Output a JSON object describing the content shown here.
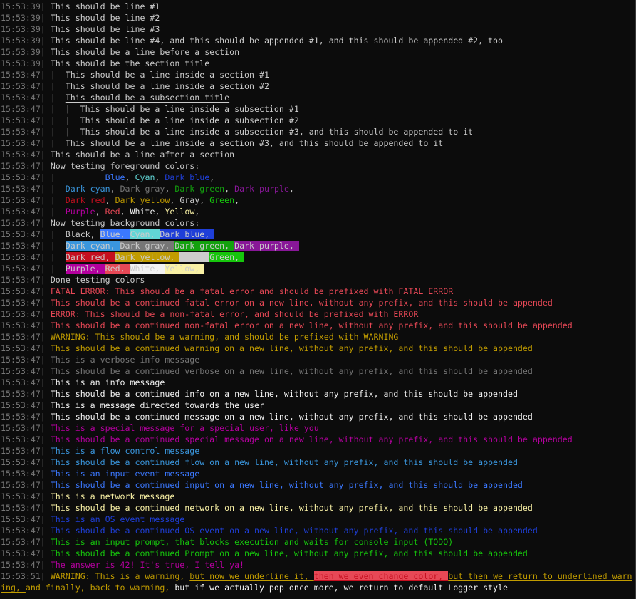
{
  "colors": {
    "default": "#cccccc",
    "timestamp": "#767676",
    "Black": "#0c0c0c",
    "Blue": "#3b78ff",
    "Cyan": "#61d6d6",
    "DarkBlue": "#1f3fd8",
    "DarkCyan": "#3a96dd",
    "DarkGray": "#767676",
    "DarkGreen": "#13a10e",
    "DarkPurple": "#881798",
    "DarkRed": "#c50f1f",
    "DarkYellow": "#c19c00",
    "Gray": "#cccccc",
    "Green": "#16c60c",
    "Purple": "#b4009e",
    "Red": "#e74856",
    "White": "#f2f2f2",
    "Yellow": "#f9f1a5"
  },
  "lines": [
    {
      "ts": "15:53:39",
      "segs": [
        {
          "t": "This should be line #1"
        }
      ]
    },
    {
      "ts": "15:53:39",
      "segs": [
        {
          "t": "This should be line #2"
        }
      ]
    },
    {
      "ts": "15:53:39",
      "segs": [
        {
          "t": "This should be line #3"
        }
      ]
    },
    {
      "ts": "15:53:39",
      "segs": [
        {
          "t": "This should be line #4, and this should be appended #1, and this should be appended #2, too"
        }
      ]
    },
    {
      "ts": "15:53:39",
      "segs": [
        {
          "t": "This should be a line before a section"
        }
      ]
    },
    {
      "ts": "15:53:39",
      "segs": [
        {
          "t": "This should be the section title",
          "u": true
        }
      ]
    },
    {
      "ts": "15:53:47",
      "segs": [
        {
          "t": "|  This should be a line inside a section #1"
        }
      ]
    },
    {
      "ts": "15:53:47",
      "segs": [
        {
          "t": "|  This should be a line inside a section #2"
        }
      ]
    },
    {
      "ts": "15:53:47",
      "segs": [
        {
          "t": "|  "
        },
        {
          "t": "This should be a subsection title",
          "u": true
        }
      ]
    },
    {
      "ts": "15:53:47",
      "segs": [
        {
          "t": "|  |  This should be a line inside a subsection #1"
        }
      ]
    },
    {
      "ts": "15:53:47",
      "segs": [
        {
          "t": "|  |  This should be a line inside a subsection #2"
        }
      ]
    },
    {
      "ts": "15:53:47",
      "segs": [
        {
          "t": "|  |  This should be a line inside a subsection #3, and this should be appended to it"
        }
      ]
    },
    {
      "ts": "15:53:47",
      "segs": [
        {
          "t": "|  This should be a line inside a section #3, and this should be appended to it"
        }
      ]
    },
    {
      "ts": "15:53:47",
      "segs": [
        {
          "t": "This should be a line after a section"
        }
      ]
    },
    {
      "ts": "15:53:47",
      "segs": [
        {
          "t": "Now testing foreground colors:"
        }
      ]
    },
    {
      "ts": "15:53:47",
      "segs": [
        {
          "t": "|  "
        },
        {
          "t": "        "
        },
        {
          "t": "Blue",
          "fg": "#3b78ff"
        },
        {
          "t": ", "
        },
        {
          "t": "Cyan",
          "fg": "#61d6d6"
        },
        {
          "t": ", "
        },
        {
          "t": "Dark blue",
          "fg": "#1f3fd8"
        },
        {
          "t": ","
        }
      ]
    },
    {
      "ts": "15:53:47",
      "segs": [
        {
          "t": "|  "
        },
        {
          "t": "Dark cyan",
          "fg": "#3a96dd"
        },
        {
          "t": ", "
        },
        {
          "t": "Dark gray",
          "fg": "#767676"
        },
        {
          "t": ", "
        },
        {
          "t": "Dark green",
          "fg": "#13a10e"
        },
        {
          "t": ", "
        },
        {
          "t": "Dark purple",
          "fg": "#881798"
        },
        {
          "t": ","
        }
      ]
    },
    {
      "ts": "15:53:47",
      "segs": [
        {
          "t": "|  "
        },
        {
          "t": "Dark red",
          "fg": "#c50f1f"
        },
        {
          "t": ", "
        },
        {
          "t": "Dark yellow",
          "fg": "#c19c00"
        },
        {
          "t": ", "
        },
        {
          "t": "Gray",
          "fg": "#cccccc"
        },
        {
          "t": ", "
        },
        {
          "t": "Green",
          "fg": "#16c60c"
        },
        {
          "t": ","
        }
      ]
    },
    {
      "ts": "15:53:47",
      "segs": [
        {
          "t": "|  "
        },
        {
          "t": "Purple",
          "fg": "#b4009e"
        },
        {
          "t": ", "
        },
        {
          "t": "Red",
          "fg": "#e74856"
        },
        {
          "t": ", "
        },
        {
          "t": "White",
          "fg": "#f2f2f2"
        },
        {
          "t": ", "
        },
        {
          "t": "Yellow",
          "fg": "#f9f1a5"
        },
        {
          "t": ","
        }
      ]
    },
    {
      "ts": "15:53:47",
      "segs": [
        {
          "t": "Now testing background colors:"
        }
      ]
    },
    {
      "ts": "15:53:47",
      "segs": [
        {
          "t": "|  "
        },
        {
          "t": "Black, ",
          "bg": "#0c0c0c"
        },
        {
          "t": "Blue, ",
          "bg": "#3b78ff"
        },
        {
          "t": "Cyan, ",
          "bg": "#61d6d6"
        },
        {
          "t": "Dark blue, ",
          "bg": "#1f3fd8"
        }
      ]
    },
    {
      "ts": "15:53:47",
      "segs": [
        {
          "t": "|  "
        },
        {
          "t": "Dark cyan, ",
          "bg": "#3a96dd"
        },
        {
          "t": "Dark gray, ",
          "bg": "#767676"
        },
        {
          "t": "Dark green, ",
          "bg": "#13a10e"
        },
        {
          "t": "Dark purple, ",
          "bg": "#881798"
        }
      ]
    },
    {
      "ts": "15:53:47",
      "segs": [
        {
          "t": "|  "
        },
        {
          "t": "Dark red, ",
          "bg": "#c50f1f"
        },
        {
          "t": "Dark yellow, ",
          "bg": "#c19c00"
        },
        {
          "t": "      ",
          "bg": "#cccccc"
        },
        {
          "t": "Green, ",
          "bg": "#16c60c"
        }
      ]
    },
    {
      "ts": "15:53:47",
      "segs": [
        {
          "t": "|  "
        },
        {
          "t": "Purple, ",
          "bg": "#b4009e"
        },
        {
          "t": "Red, ",
          "bg": "#e74856"
        },
        {
          "t": "White, ",
          "bg": "#f2f2f2"
        },
        {
          "t": "Yellow, ",
          "bg": "#f9f1a5"
        }
      ]
    },
    {
      "ts": "15:53:47",
      "segs": [
        {
          "t": "Done testing colors"
        }
      ]
    },
    {
      "ts": "15:53:47",
      "segs": [
        {
          "t": "FATAL ERROR: This should be a fatal error and should be prefixed with FATAL ERROR",
          "fg": "#e74856"
        }
      ]
    },
    {
      "ts": "15:53:47",
      "segs": [
        {
          "t": "This should be a continued fatal error on a new line, without any prefix, and this should be appended",
          "fg": "#e74856"
        }
      ]
    },
    {
      "ts": "15:53:47",
      "segs": [
        {
          "t": "ERROR: This should be a non-fatal error, and should be prefixed with ERROR",
          "fg": "#e74856"
        }
      ]
    },
    {
      "ts": "15:53:47",
      "segs": [
        {
          "t": "This should be a continued non-fatal error on a new line, without any prefix, and this should be appended",
          "fg": "#e74856"
        }
      ]
    },
    {
      "ts": "15:53:47",
      "segs": [
        {
          "t": "WARNING: This should be a warning, and should be prefixed with WARNING",
          "fg": "#c19c00"
        }
      ]
    },
    {
      "ts": "15:53:47",
      "segs": [
        {
          "t": "This should be a continued warning on a new line, without any prefix, and this should be appended",
          "fg": "#c19c00"
        }
      ]
    },
    {
      "ts": "15:53:47",
      "segs": [
        {
          "t": "This is a verbose info message",
          "fg": "#767676"
        }
      ]
    },
    {
      "ts": "15:53:47",
      "segs": [
        {
          "t": "This should be a continued verbose on a new line, without any prefix, and this should be appended",
          "fg": "#767676"
        }
      ]
    },
    {
      "ts": "15:53:47",
      "segs": [
        {
          "t": "This is an info message",
          "fg": "#f2f2f2"
        }
      ]
    },
    {
      "ts": "15:53:47",
      "segs": [
        {
          "t": "This should be a continued info on a new line, without any prefix, and this should be appended",
          "fg": "#f2f2f2"
        }
      ]
    },
    {
      "ts": "15:53:47",
      "segs": [
        {
          "t": "This is a message directed towards the user",
          "fg": "#f2f2f2"
        }
      ]
    },
    {
      "ts": "15:53:47",
      "segs": [
        {
          "t": "This should be a continued message on a new line, without any prefix, and this should be appended",
          "fg": "#f2f2f2"
        }
      ]
    },
    {
      "ts": "15:53:47",
      "segs": [
        {
          "t": "This is a special message for a special user, like you",
          "fg": "#b4009e"
        }
      ]
    },
    {
      "ts": "15:53:47",
      "segs": [
        {
          "t": "This should be a continued special message on a new line, without any prefix, and this should be appended",
          "fg": "#b4009e"
        }
      ]
    },
    {
      "ts": "15:53:47",
      "segs": [
        {
          "t": "This is a flow control message",
          "fg": "#3a96dd"
        }
      ]
    },
    {
      "ts": "15:53:47",
      "segs": [
        {
          "t": "This should be a continued flow on a new line, without any prefix, and this should be appended",
          "fg": "#3a96dd"
        }
      ]
    },
    {
      "ts": "15:53:47",
      "segs": [
        {
          "t": "This is an input event message",
          "fg": "#3b78ff"
        }
      ]
    },
    {
      "ts": "15:53:47",
      "segs": [
        {
          "t": "This should be a continued input on a new line, without any prefix, and this should be appended",
          "fg": "#3b78ff"
        }
      ]
    },
    {
      "ts": "15:53:47",
      "segs": [
        {
          "t": "This is a network message",
          "fg": "#f9f1a5"
        }
      ]
    },
    {
      "ts": "15:53:47",
      "segs": [
        {
          "t": "This should be a continued network on a new line, without any prefix, and this should be appended",
          "fg": "#f9f1a5"
        }
      ]
    },
    {
      "ts": "15:53:47",
      "segs": [
        {
          "t": "This is an OS event message",
          "fg": "#1f3fd8"
        }
      ]
    },
    {
      "ts": "15:53:47",
      "segs": [
        {
          "t": "This should be a continued OS event on a new line, without any prefix, and this should be appended",
          "fg": "#1f3fd8"
        }
      ]
    },
    {
      "ts": "15:53:47",
      "segs": [
        {
          "t": "This is an input prompt, that blocks execution and waits for console input (TODO)",
          "fg": "#16c60c"
        }
      ]
    },
    {
      "ts": "15:53:47",
      "segs": [
        {
          "t": "This should be a continued Prompt on a new line, without any prefix, and this should be appended",
          "fg": "#16c60c"
        }
      ]
    },
    {
      "ts": "15:53:47",
      "segs": [
        {
          "t": "The answer is 42! It's true, I tell ya!",
          "fg": "#b4009e"
        }
      ]
    },
    {
      "ts": "15:53:51",
      "segs": [
        {
          "t": "WARNING: This is a warning, ",
          "fg": "#c19c00"
        },
        {
          "t": "but now we underline it, ",
          "fg": "#c19c00",
          "u": true
        },
        {
          "t": "then we even change color, ",
          "fg": "#c50f1f",
          "bg": "#e74856",
          "u": true
        },
        {
          "t": "but then we return to underlined warn",
          "fg": "#c19c00",
          "u": true
        }
      ]
    },
    {
      "segs": [
        {
          "t": "ing, ",
          "fg": "#c19c00",
          "u": true
        },
        {
          "t": "and finally, back to warning, ",
          "fg": "#c19c00"
        },
        {
          "t": "but if we actually pop once more, we return to default Logger style",
          "fg": "#f2f2f2"
        }
      ]
    }
  ]
}
